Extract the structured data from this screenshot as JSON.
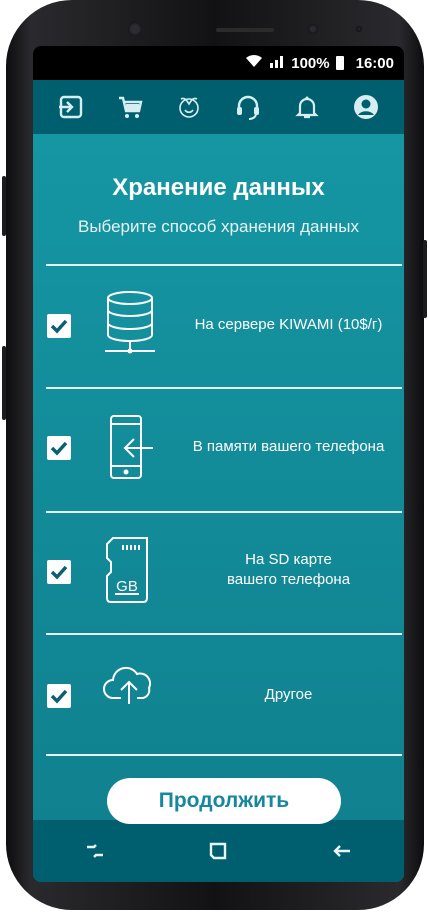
{
  "status_bar": {
    "wifi_icon": "wifi-icon",
    "signal_icon": "signal-icon",
    "battery_level": "100%",
    "time": "16:00"
  },
  "top_nav": {
    "items": [
      {
        "icon": "exit-icon"
      },
      {
        "icon": "cart-icon"
      },
      {
        "icon": "logo-icon"
      },
      {
        "icon": "headset-icon"
      },
      {
        "icon": "bell-icon"
      },
      {
        "icon": "user-icon"
      }
    ]
  },
  "page": {
    "title": "Хранение данных",
    "subtitle": "Выберите способ хранения данных"
  },
  "options": [
    {
      "icon": "database-server-icon",
      "label": "На сервере KIWAMI (10$/г)",
      "checked": true
    },
    {
      "icon": "phone-memory-icon",
      "label": "В памяти вашего телефона",
      "checked": true
    },
    {
      "icon": "sd-card-icon",
      "label_line1": "На SD карте",
      "label_line2": "вашего телефона",
      "sd_text": "GB",
      "checked": true
    },
    {
      "icon": "cloud-upload-icon",
      "label": "Другое",
      "checked": true
    }
  ],
  "continue_button": {
    "label": "Продолжить"
  },
  "system_nav": {
    "items": [
      {
        "icon": "recent-apps-icon"
      },
      {
        "icon": "home-icon"
      },
      {
        "icon": "back-icon"
      }
    ]
  },
  "colors": {
    "accent": "#1596a3",
    "nav_bar": "#005f6f",
    "button_text": "#1787a0"
  }
}
